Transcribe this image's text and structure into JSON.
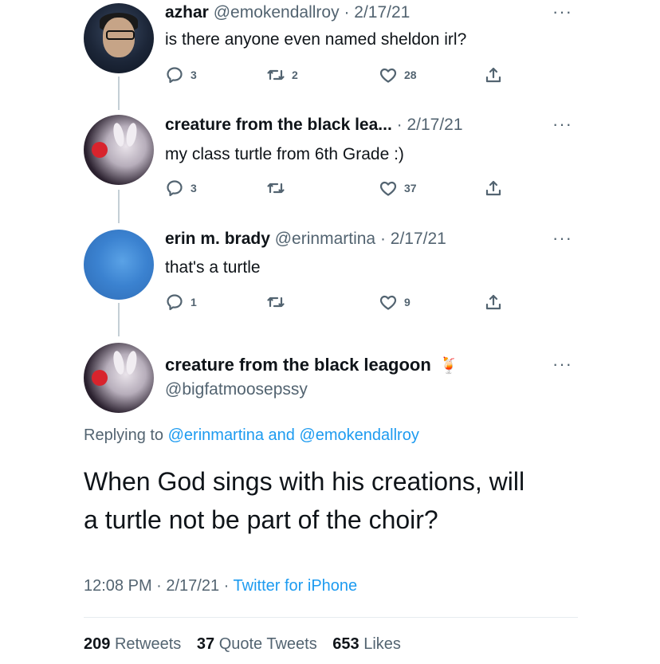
{
  "tweets": [
    {
      "name": "azhar",
      "handle": "@emokendallroy",
      "date": "· 2/17/21",
      "text": "is there anyone even named sheldon irl?",
      "replies": "3",
      "retweets": "2",
      "likes": "28"
    },
    {
      "name": "creature from the black lea...",
      "handle": "",
      "date": "· 2/17/21",
      "text": "my class turtle from 6th Grade :)",
      "replies": "3",
      "retweets": "",
      "likes": "37"
    },
    {
      "name": "erin m. brady",
      "handle": "@erinmartina",
      "date": "· 2/17/21",
      "text": "that's a turtle",
      "replies": "1",
      "retweets": "",
      "likes": "9"
    }
  ],
  "more_label": "···",
  "main": {
    "name": "creature from the black leagoon",
    "emoji": "🍹",
    "handle": "@bigfatmoosepssy",
    "replying_prefix": "Replying to",
    "mention1": "@erinmartina",
    "and_word": "and",
    "mention2": "@emokendallroy",
    "text_line1": "When God sings with his creations, will",
    "text_line2": "a turtle not be part of the choir?",
    "time": "12:08 PM · 2/17/21 ·",
    "source": "Twitter for iPhone",
    "retweets_count": "209",
    "retweets_label": "Retweets",
    "quotes_count": "37",
    "quotes_label": "Quote Tweets",
    "likes_count": "653",
    "likes_label": "Likes"
  },
  "icons": [
    "reply-icon",
    "retweet-icon",
    "like-icon",
    "share-icon",
    "more-icon"
  ],
  "colors": {
    "link": "#1d9bf0",
    "secondary": "#536471",
    "thread_line": "#c4cfd6"
  }
}
